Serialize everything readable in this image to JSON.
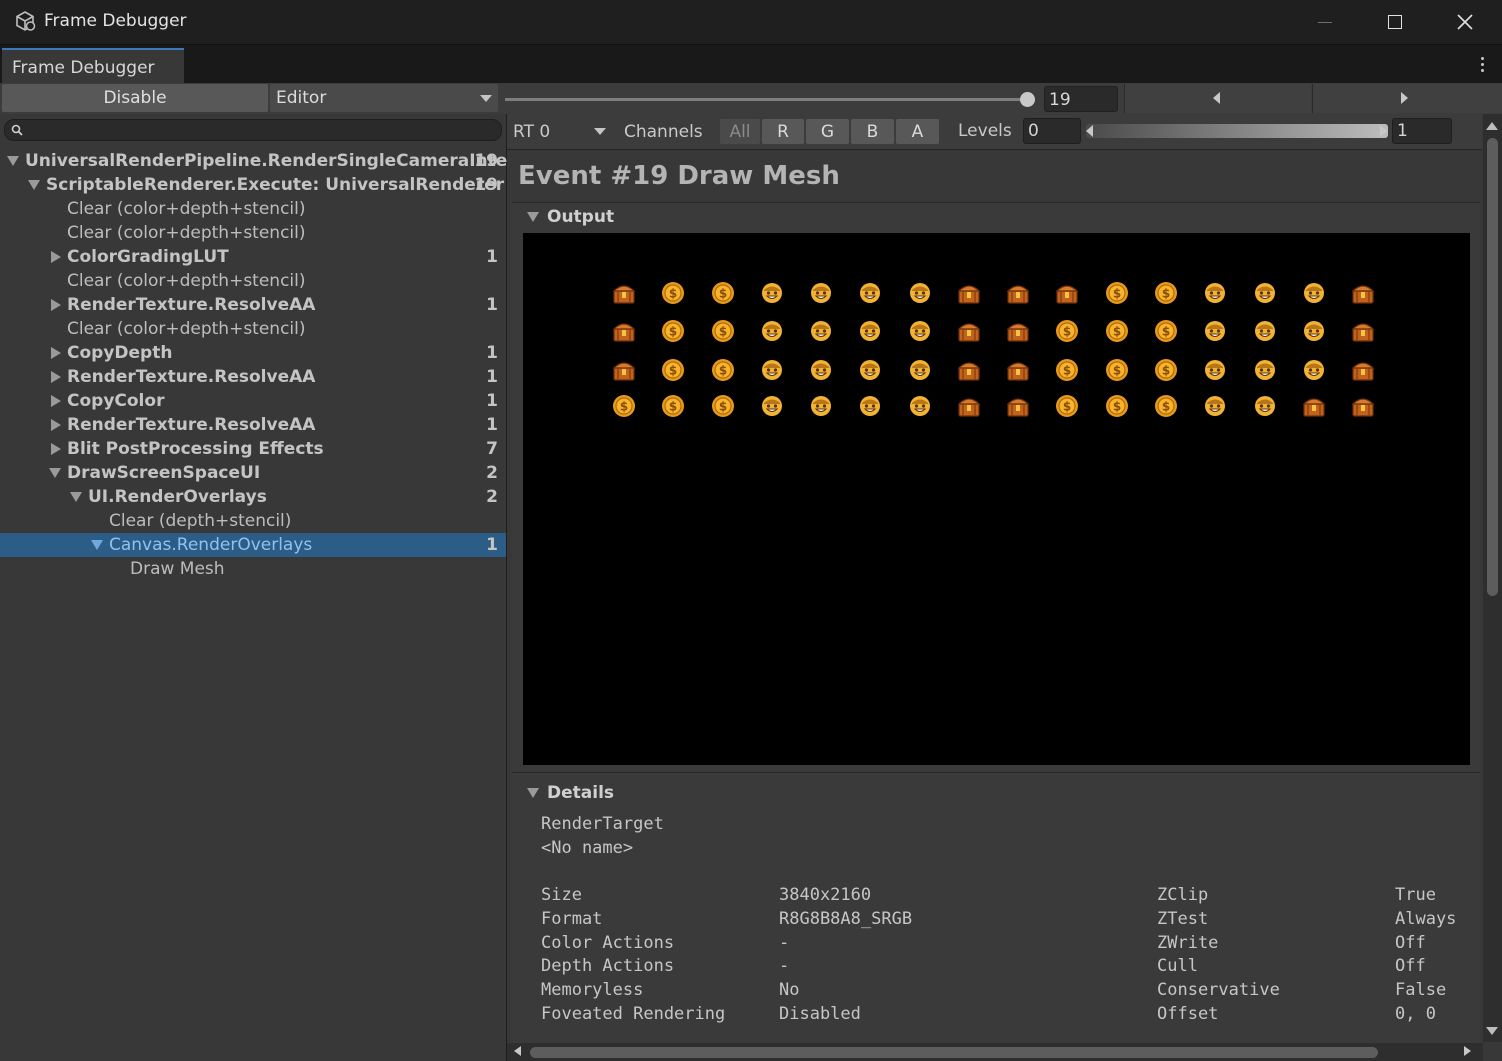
{
  "window": {
    "title": "Frame Debugger",
    "icon": "unity-cube-icon",
    "controls": [
      "minimize-icon",
      "maximize-icon",
      "close-icon"
    ]
  },
  "tab": {
    "label": "Frame Debugger",
    "menu_icon": "kebab-menu-icon"
  },
  "toolbar": {
    "disable_label": "Disable",
    "target_dropdown": "Editor",
    "event_index": "19",
    "slider_fraction": 1.0
  },
  "search": {
    "placeholder": "",
    "icon": "search-icon"
  },
  "tree": [
    {
      "label": "UniversalRenderPipeline.RenderSingleCameraInter",
      "count": "19",
      "depth": 0,
      "expander": "expanded",
      "bold": true
    },
    {
      "label": "ScriptableRenderer.Execute: UniversalRenderer",
      "count": "19",
      "depth": 1,
      "expander": "expanded",
      "bold": true
    },
    {
      "label": "Clear (color+depth+stencil)",
      "count": "",
      "depth": 2,
      "expander": "none",
      "bold": false
    },
    {
      "label": "Clear (color+depth+stencil)",
      "count": "",
      "depth": 2,
      "expander": "none",
      "bold": false
    },
    {
      "label": "ColorGradingLUT",
      "count": "1",
      "depth": 2,
      "expander": "collapsed",
      "bold": true
    },
    {
      "label": "Clear (color+depth+stencil)",
      "count": "",
      "depth": 2,
      "expander": "none",
      "bold": false
    },
    {
      "label": "RenderTexture.ResolveAA",
      "count": "1",
      "depth": 2,
      "expander": "collapsed",
      "bold": true
    },
    {
      "label": "Clear (color+depth+stencil)",
      "count": "",
      "depth": 2,
      "expander": "none",
      "bold": false
    },
    {
      "label": "CopyDepth",
      "count": "1",
      "depth": 2,
      "expander": "collapsed",
      "bold": true
    },
    {
      "label": "RenderTexture.ResolveAA",
      "count": "1",
      "depth": 2,
      "expander": "collapsed",
      "bold": true
    },
    {
      "label": "CopyColor",
      "count": "1",
      "depth": 2,
      "expander": "collapsed",
      "bold": true
    },
    {
      "label": "RenderTexture.ResolveAA",
      "count": "1",
      "depth": 2,
      "expander": "collapsed",
      "bold": true
    },
    {
      "label": "Blit PostProcessing Effects",
      "count": "7",
      "depth": 2,
      "expander": "collapsed",
      "bold": true
    },
    {
      "label": "DrawScreenSpaceUI",
      "count": "2",
      "depth": 2,
      "expander": "expanded",
      "bold": true
    },
    {
      "label": "UI.RenderOverlays",
      "count": "2",
      "depth": 3,
      "expander": "expanded",
      "bold": true
    },
    {
      "label": "Clear (depth+stencil)",
      "count": "",
      "depth": 4,
      "expander": "none",
      "bold": false
    },
    {
      "label": "Canvas.RenderOverlays",
      "count": "1",
      "depth": 4,
      "expander": "expanded",
      "bold": false,
      "selected": true
    },
    {
      "label": "Draw Mesh",
      "count": "",
      "depth": 5,
      "expander": "none",
      "bold": false
    }
  ],
  "rt_toolbar": {
    "rt_select": "RT 0",
    "channels_label": "Channels",
    "channels": [
      {
        "label": "All",
        "active": false
      },
      {
        "label": "R",
        "active": true
      },
      {
        "label": "G",
        "active": true
      },
      {
        "label": "B",
        "active": true
      },
      {
        "label": "A",
        "active": true
      }
    ],
    "levels_label": "Levels",
    "levels_min": "0",
    "levels_max": "1"
  },
  "event": {
    "title": "Event #19 Draw Mesh"
  },
  "output": {
    "header": "Output",
    "grid": [
      [
        "chest",
        "coin",
        "coin",
        "smiley",
        "smiley",
        "smiley",
        "smiley",
        "chest",
        "chest",
        "chest",
        "coin",
        "coin",
        "smiley",
        "smiley",
        "smiley",
        "chest"
      ],
      [
        "chest",
        "coin",
        "coin",
        "smiley",
        "smiley",
        "smiley",
        "smiley",
        "chest",
        "chest",
        "coin",
        "coin",
        "coin",
        "smiley",
        "smiley",
        "smiley",
        "chest"
      ],
      [
        "chest",
        "coin",
        "coin",
        "smiley",
        "smiley",
        "smiley",
        "smiley",
        "chest",
        "chest",
        "coin",
        "coin",
        "coin",
        "smiley",
        "smiley",
        "smiley",
        "chest"
      ],
      [
        "coin",
        "coin",
        "coin",
        "smiley",
        "smiley",
        "smiley",
        "smiley",
        "chest",
        "chest",
        "coin",
        "coin",
        "coin",
        "smiley",
        "smiley",
        "chest",
        "chest"
      ]
    ]
  },
  "details": {
    "header": "Details",
    "render_target_label": "RenderTarget",
    "render_target_name": "<No name>",
    "left_rows": [
      {
        "key": "Size",
        "value": "3840x2160"
      },
      {
        "key": "Format",
        "value": "R8G8B8A8_SRGB"
      },
      {
        "key": "Color Actions",
        "value": "-"
      },
      {
        "key": "Depth Actions",
        "value": "-"
      },
      {
        "key": "Memoryless",
        "value": "No"
      },
      {
        "key": "Foveated Rendering",
        "value": "Disabled"
      }
    ],
    "right_rows": [
      {
        "key": "ZClip",
        "value": "True"
      },
      {
        "key": "ZTest",
        "value": "Always"
      },
      {
        "key": "ZWrite",
        "value": "Off"
      },
      {
        "key": "Cull",
        "value": "Off"
      },
      {
        "key": "Conservative",
        "value": "False"
      },
      {
        "key": "Offset",
        "value": "0, 0"
      }
    ]
  },
  "colors": {
    "selection": "#2c5d87",
    "tab_accent": "#3a79bb",
    "coin": "#e89a1a",
    "chest": "#c2621c"
  }
}
